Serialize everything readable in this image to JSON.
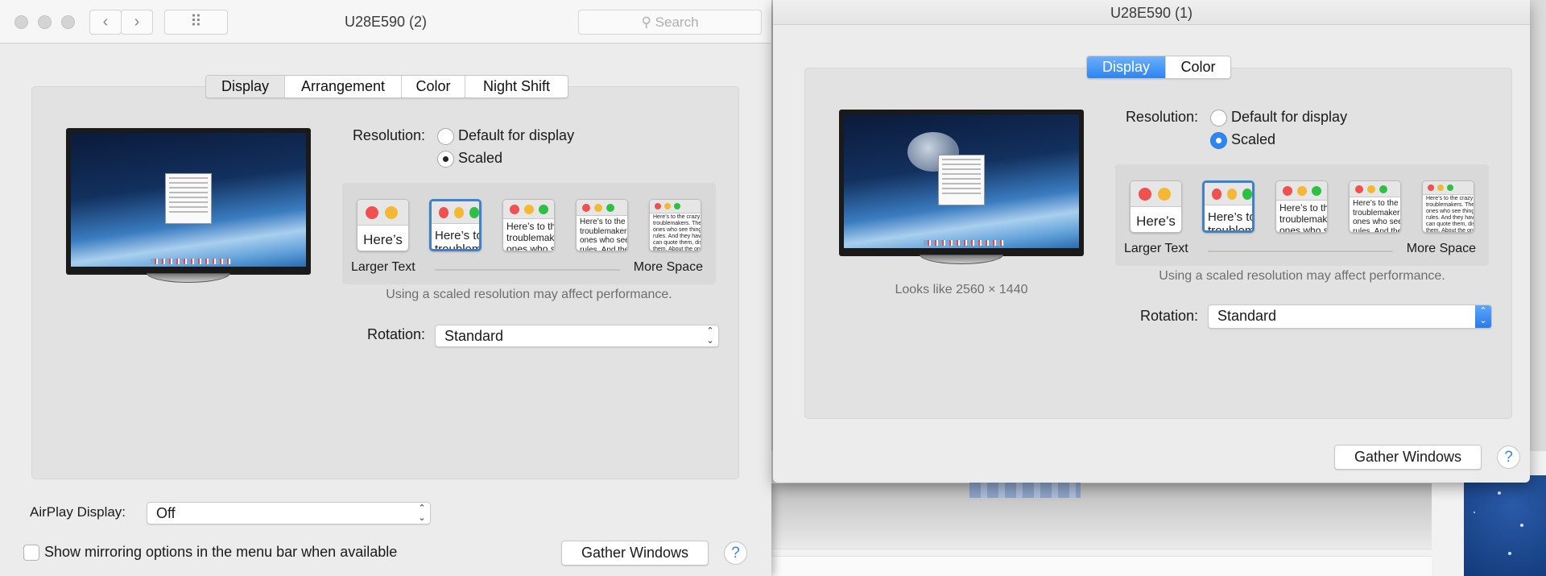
{
  "left_window": {
    "title": "U28E590 (2)",
    "search_placeholder": "Search",
    "nav": {
      "back": "‹",
      "forward": "›",
      "grid": "⠿"
    },
    "tabs": [
      {
        "label": "Display",
        "selected": true
      },
      {
        "label": "Arrangement"
      },
      {
        "label": "Color"
      },
      {
        "label": "Night Shift"
      }
    ],
    "resolution_label": "Resolution:",
    "resolution_options": [
      {
        "label": "Default for display",
        "selected": false
      },
      {
        "label": "Scaled",
        "selected": true
      }
    ],
    "scale_left_label": "Larger Text",
    "scale_right_label": "More Space",
    "scale_selected_index": 1,
    "performance_note": "Using a scaled resolution may affect performance.",
    "rotation_label": "Rotation:",
    "rotation_value": "Standard",
    "airplay_label": "AirPlay Display:",
    "airplay_value": "Off",
    "mirroring_checkbox": {
      "label": "Show mirroring options in the menu bar when available",
      "checked": false
    },
    "gather_button": "Gather Windows",
    "help": "?"
  },
  "right_window": {
    "title": "U28E590 (1)",
    "tabs": [
      {
        "label": "Display",
        "selected": true
      },
      {
        "label": "Color"
      }
    ],
    "looks_like": "Looks like 2560 × 1440",
    "resolution_label": "Resolution:",
    "resolution_options": [
      {
        "label": "Default for display",
        "selected": false
      },
      {
        "label": "Scaled",
        "selected": true
      }
    ],
    "scale_left_label": "Larger Text",
    "scale_right_label": "More Space",
    "scale_selected_index": 1,
    "performance_note": "Using a scaled resolution may affect performance.",
    "rotation_label": "Rotation:",
    "rotation_value": "Standard",
    "gather_button": "Gather Windows",
    "help": "?"
  },
  "thumb_texts": [
    "Here’s",
    "Here’s to the\ntroublemakers",
    "Here’s to the\ntroublemakers.\nones who see",
    "Here’s to the crazy\ntroublemakers. The\nones who see things\nrules. And they",
    "Here’s to the crazy ones\ntroublemakers. The rou\nones who see things di\nrules. And they have no\ncan quote them, disagr\nthem. About the only th\nBecause they change t"
  ],
  "colors": {
    "accent": "#2c84f2",
    "selected_thumb": "#3f82c9",
    "red": "#f0504f",
    "yellow": "#f5b834",
    "green": "#2fc043"
  }
}
